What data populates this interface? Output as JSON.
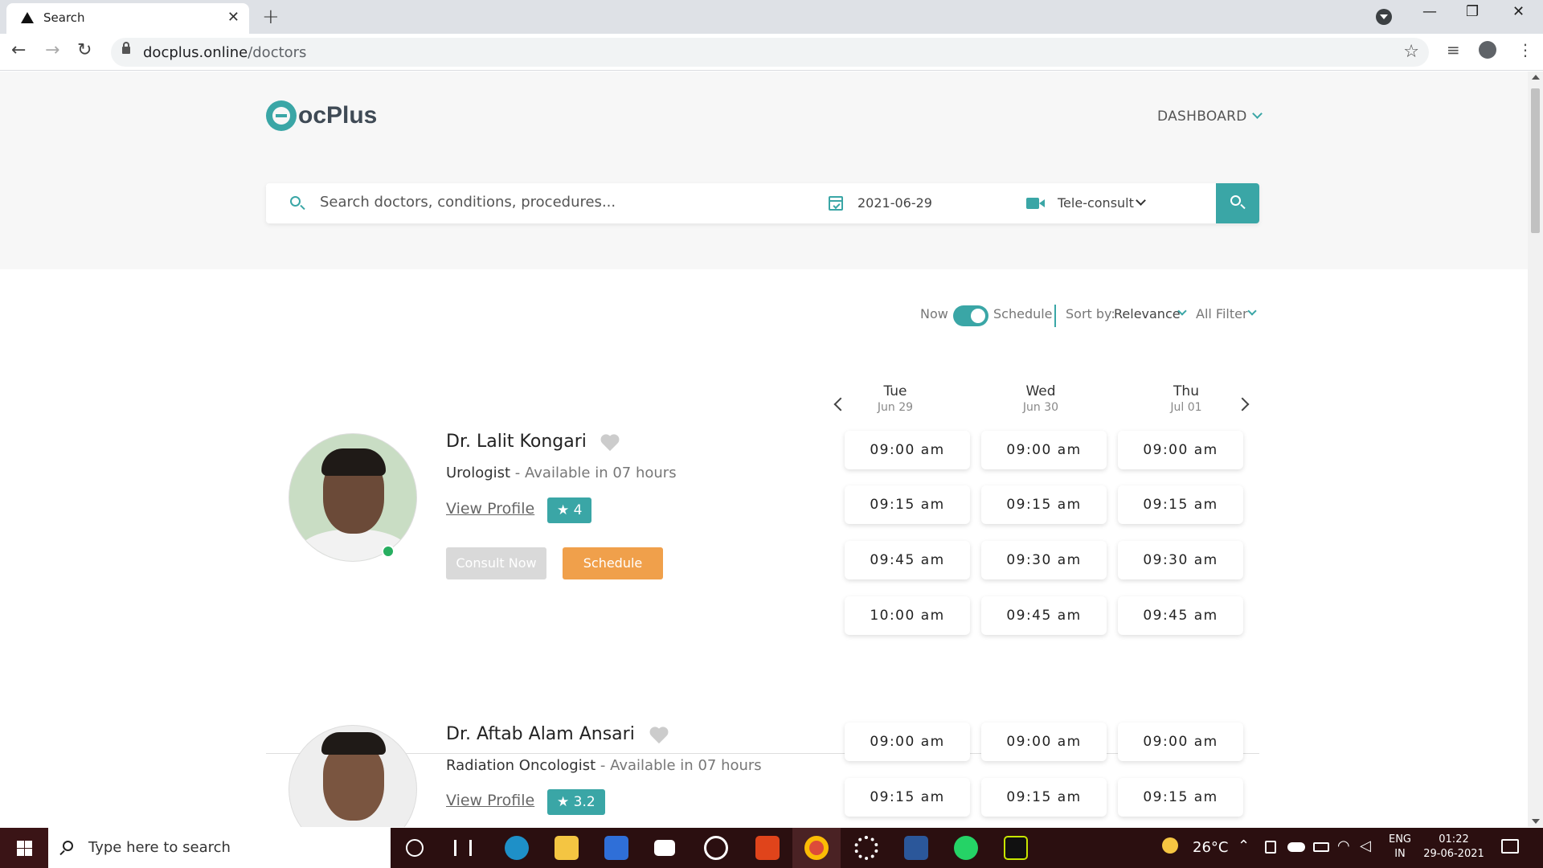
{
  "browser": {
    "tab_title": "Search",
    "tab_close": "✕",
    "new_tab": "+",
    "url_host": "docplus.online",
    "url_path": "/doctors",
    "window_controls": [
      "—",
      "❐",
      "✕"
    ]
  },
  "site": {
    "logo_text": "ocPlus",
    "dashboard_label": "DASHBOARD"
  },
  "search": {
    "placeholder": "Search doctors, conditions, procedures...",
    "date": "2021-06-29",
    "mode": "Tele-consult"
  },
  "filters": {
    "now_label": "Now",
    "schedule_label": "Schedule",
    "toggle_on": true,
    "sort_label": "Sort by:",
    "sort_value": "Relevance",
    "filter_label": "All Filter"
  },
  "days": [
    {
      "day": "Tue",
      "date": "Jun 29"
    },
    {
      "day": "Wed",
      "date": "Jun 30"
    },
    {
      "day": "Thu",
      "date": "Jul 01"
    }
  ],
  "doctors": [
    {
      "name": "Dr. Lalit Kongari",
      "specialty": "Urologist",
      "availability": " - Available in 07 hours",
      "view_profile": "View Profile",
      "rating": "★ 4",
      "consult_label": "Consult Now",
      "schedule_label": "Schedule",
      "online": true,
      "slots": [
        [
          "09:00 am",
          "09:15 am",
          "09:45 am",
          "10:00 am"
        ],
        [
          "09:00 am",
          "09:15 am",
          "09:30 am",
          "09:45 am"
        ],
        [
          "09:00 am",
          "09:15 am",
          "09:30 am",
          "09:45 am"
        ]
      ]
    },
    {
      "name": "Dr. Aftab Alam Ansari",
      "specialty": "Radiation Oncologist",
      "availability": " - Available in 07 hours",
      "view_profile": "View Profile",
      "rating": "★ 3.2",
      "slots": [
        [
          "09:00 am",
          "09:15 am"
        ],
        [
          "09:00 am",
          "09:15 am"
        ],
        [
          "09:00 am",
          "09:15 am"
        ]
      ]
    }
  ],
  "taskbar": {
    "search_placeholder": "Type here to search",
    "weather": "26°C",
    "lang_top": "ENG",
    "lang_bottom": "IN",
    "time": "01:22",
    "date": "29-06-2021"
  },
  "colors": {
    "accent": "#3aa6a6",
    "schedule_button": "#f0a04b",
    "online_dot": "#27ae60"
  }
}
